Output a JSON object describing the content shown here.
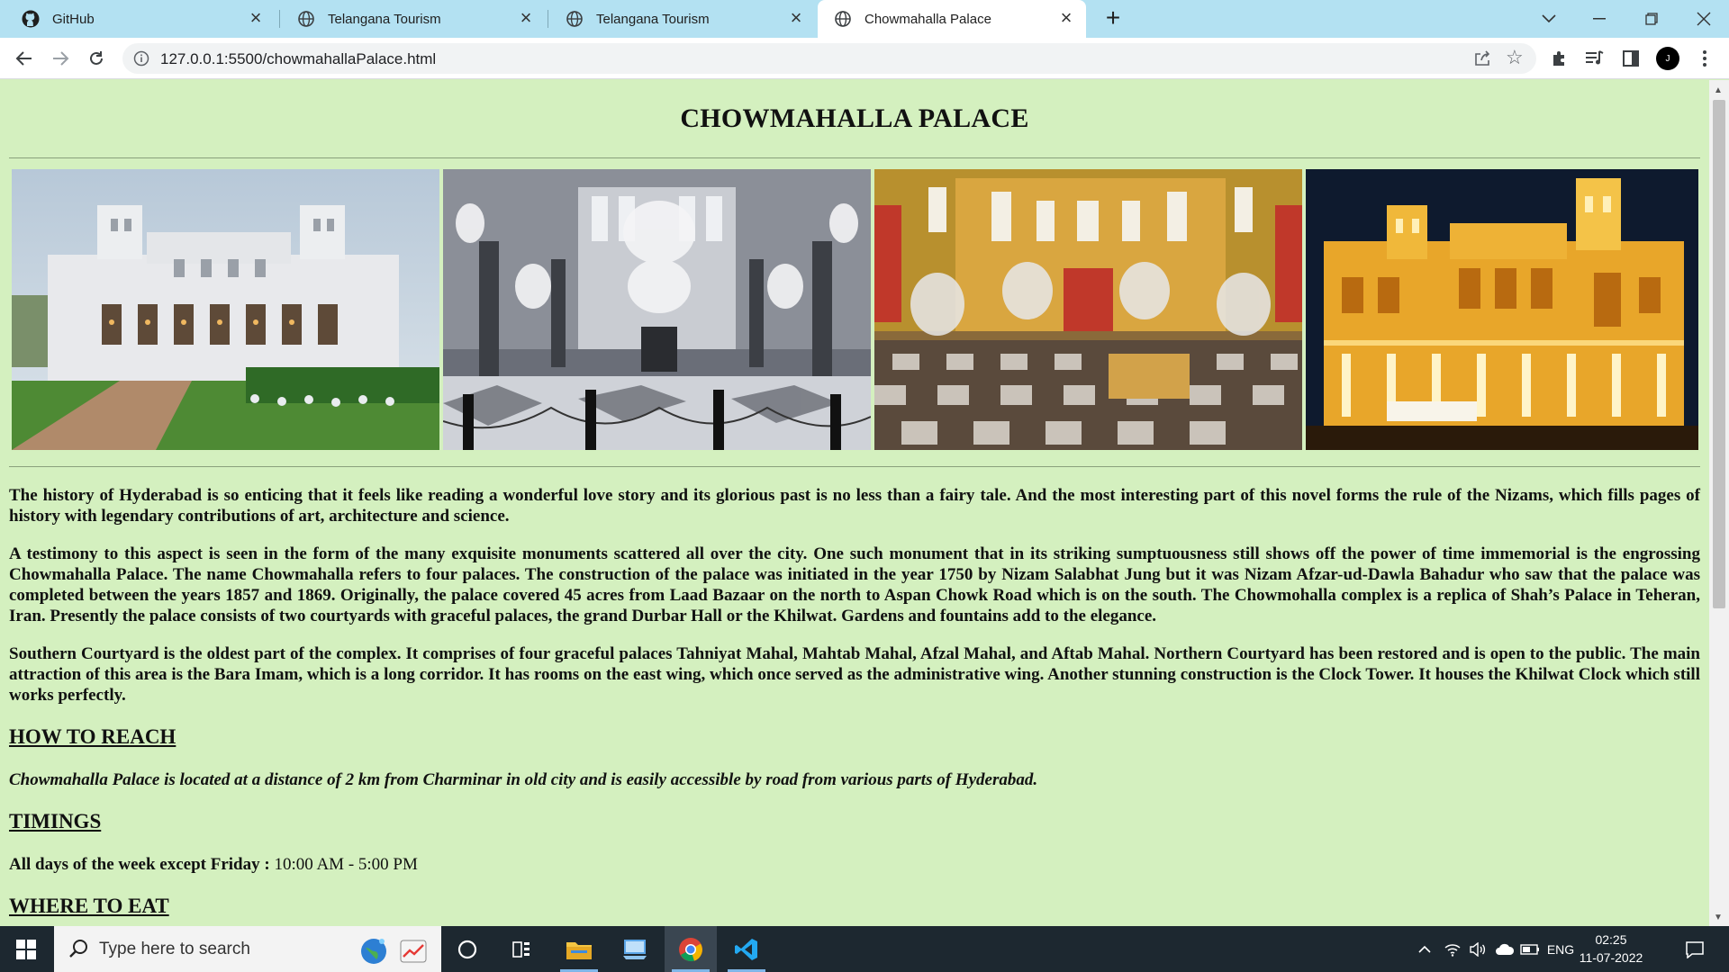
{
  "browser": {
    "tabs": [
      {
        "title": "GitHub",
        "icon": "github-icon"
      },
      {
        "title": "Telangana Tourism",
        "icon": "globe-icon"
      },
      {
        "title": "Telangana Tourism",
        "icon": "globe-icon"
      },
      {
        "title": "Chowmahalla Palace",
        "icon": "globe-icon",
        "active": true
      }
    ],
    "url": "127.0.0.1:5500/chowmahallaPalace.html",
    "avatar_letter": "J",
    "accent": "#b3e1f2"
  },
  "page": {
    "title": "CHOWMAHALLA PALACE",
    "background": "#d4f0bf",
    "images": [
      {
        "name": "palace-exterior-day"
      },
      {
        "name": "palace-durbar-hall-chandeliers"
      },
      {
        "name": "palace-hall-interior"
      },
      {
        "name": "palace-illuminated-night"
      }
    ],
    "paragraphs": [
      "The history of Hyderabad is so enticing that it feels like reading a wonderful love story and its glorious past is no less than a fairy tale. And the most interesting part of this novel forms the rule of the Nizams, which fills pages of history with legendary contributions of art, architecture and science.",
      "A testimony to this aspect is seen in the form of the many exquisite monuments scattered all over the city. One such monument that in its striking sumptuousness still shows off the power of time immemorial is the engrossing Chowmahalla Palace. The name Chowmahalla refers to four palaces. The construction of the palace was initiated in the year 1750 by Nizam Salabhat Jung but it was Nizam Afzar-ud-Dawla Bahadur who saw that the palace was completed between the years 1857 and 1869. Originally, the palace covered 45 acres from Laad Bazaar on the north to Aspan Chowk Road which is on the south. The Chowmohalla complex is a replica of Shah’s Palace in Teheran, Iran. Presently the palace consists of two courtyards with graceful palaces, the grand Durbar Hall or the Khilwat. Gardens and fountains add to the elegance.",
      "Southern Courtyard is the oldest part of the complex. It comprises of four graceful palaces Tahniyat Mahal, Mahtab Mahal, Afzal Mahal, and Aftab Mahal. Northern Courtyard has been restored and is open to the public. The main attraction of this area is the Bara Imam, which is a long corridor. It has rooms on the east wing, which once served as the administrative wing. Another stunning construction is the Clock Tower. It houses the Khilwat Clock which still works perfectly."
    ],
    "how_to_reach": {
      "heading": "HOW TO REACH",
      "text": "Chowmahalla Palace is located at a distance of 2 km from Charminar in old city and is easily accessible by road from various parts of Hyderabad."
    },
    "timings": {
      "heading": "TIMINGS",
      "label": "All days of the week except Friday :",
      "value": "10:00 AM - 5:00 PM"
    },
    "where_to_eat": {
      "heading": "WHERE TO EAT"
    }
  },
  "taskbar": {
    "search_placeholder": "Type here to search",
    "language": "ENG",
    "time": "02:25",
    "date": "11-07-2022",
    "apps": [
      "cortana-icon",
      "task-view-icon",
      "file-explorer-icon",
      "computer-icon",
      "chrome-icon",
      "vscode-icon"
    ]
  }
}
